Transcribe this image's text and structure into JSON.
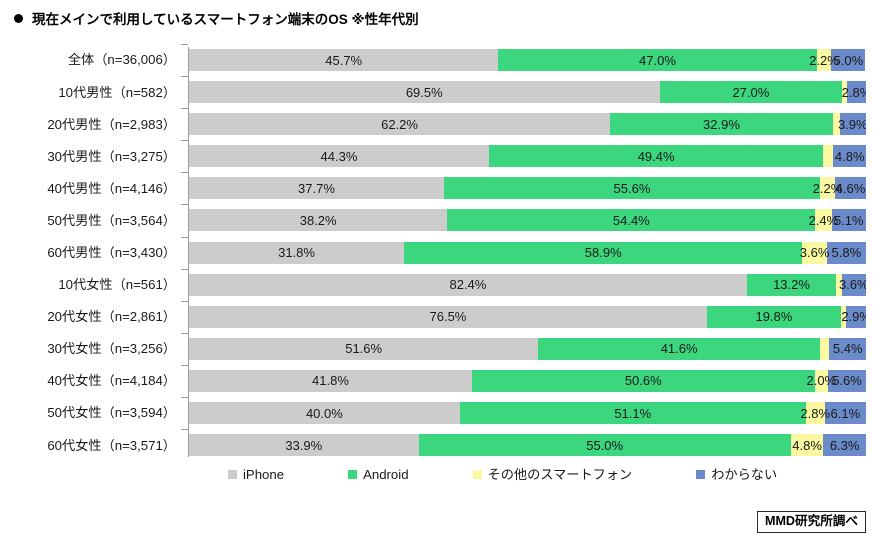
{
  "title": {
    "bullet": "bullet-icon",
    "text": "現在メインで利用しているスマートフォン端末のOS ※性年代別"
  },
  "footer": {
    "source": "MMD研究所調べ"
  },
  "legend": {
    "items": [
      {
        "label": "iPhone",
        "color": "#CCCCCC"
      },
      {
        "label": "Android",
        "color": "#3BD67E"
      },
      {
        "label": "その他のスマートフォン",
        "color": "#FAF8A0"
      },
      {
        "label": "わからない",
        "color": "#6A8AC9"
      }
    ]
  },
  "chart_data": {
    "type": "bar",
    "orientation": "horizontal",
    "stacked": true,
    "normalized": true,
    "title": "現在メインで利用しているスマートフォン端末のOS ※性年代別",
    "xlabel": "",
    "ylabel": "",
    "xlim": [
      0,
      100
    ],
    "grid": false,
    "legend_position": "bottom",
    "value_suffix": "%",
    "colors": {
      "iPhone": "#CCCCCC",
      "Android": "#3BD67E",
      "other": "#FAF8A0",
      "unknown": "#6A8AC9"
    },
    "categories": [
      "全体（n=36,006）",
      "10代男性（n=582）",
      "20代男性（n=2,983）",
      "30代男性（n=3,275）",
      "40代男性（n=4,146）",
      "50代男性（n=3,564）",
      "60代男性（n=3,430）",
      "10代女性（n=561）",
      "20代女性（n=2,861）",
      "30代女性（n=3,256）",
      "40代女性（n=4,184）",
      "50代女性（n=3,594）",
      "60代女性（n=3,571）"
    ],
    "series": [
      {
        "name": "iPhone",
        "color": "#CCCCCC",
        "values": [
          45.7,
          69.5,
          62.2,
          44.3,
          37.7,
          38.2,
          31.8,
          82.4,
          76.5,
          51.6,
          41.8,
          40.0,
          33.9
        ],
        "labels": [
          "45.7%",
          "69.5%",
          "62.2%",
          "44.3%",
          "37.7%",
          "38.2%",
          "31.8%",
          "82.4%",
          "76.5%",
          "51.6%",
          "41.8%",
          "40.0%",
          "33.9%"
        ]
      },
      {
        "name": "Android",
        "color": "#3BD67E",
        "values": [
          47.0,
          27.0,
          32.9,
          49.4,
          55.6,
          54.4,
          58.9,
          13.2,
          19.8,
          41.6,
          50.6,
          51.1,
          55.0
        ],
        "labels": [
          "47.0%",
          "27.0%",
          "32.9%",
          "49.4%",
          "55.6%",
          "54.4%",
          "58.9%",
          "13.2%",
          "19.8%",
          "41.6%",
          "50.6%",
          "51.1%",
          "55.0%"
        ]
      },
      {
        "name": "その他のスマートフォン",
        "color": "#FAF8A0",
        "values": [
          2.2,
          0.7,
          1.0,
          1.5,
          2.2,
          2.4,
          3.6,
          0.8,
          0.8,
          1.4,
          2.0,
          2.8,
          4.8
        ],
        "labels": [
          "2.2%",
          "",
          "",
          "",
          "2.2%",
          "2.4%",
          "3.6%",
          "",
          "",
          "",
          "2.0%",
          "2.8%",
          "4.8%"
        ]
      },
      {
        "name": "わからない",
        "color": "#6A8AC9",
        "values": [
          5.0,
          2.8,
          3.9,
          4.8,
          4.6,
          5.1,
          5.8,
          3.6,
          2.9,
          5.4,
          5.6,
          6.1,
          6.3
        ],
        "labels": [
          "5.0%",
          "2.8%",
          "3.9%",
          "4.8%",
          "4.6%",
          "5.1%",
          "5.8%",
          "3.6%",
          "2.9%",
          "5.4%",
          "5.6%",
          "6.1%",
          "6.3%"
        ]
      }
    ]
  }
}
